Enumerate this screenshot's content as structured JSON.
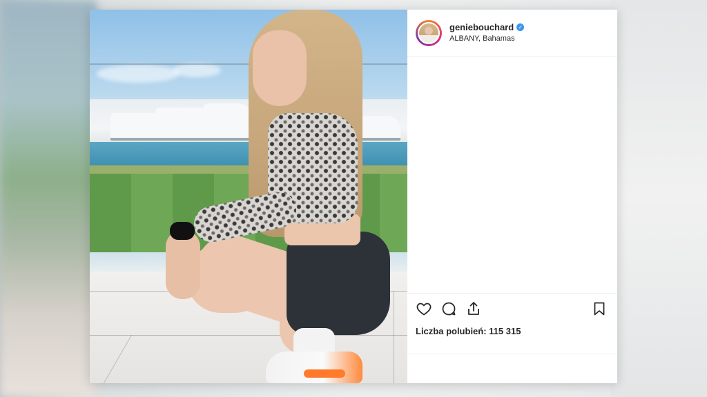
{
  "post": {
    "username": "geniebouchard",
    "verified": true,
    "location": "ALBANY, Bahamas",
    "likes_text": "Liczba polubień: 115 315"
  },
  "icons": {
    "like": "heart-outline-icon",
    "comment": "speech-bubble-icon",
    "share": "share-upload-icon",
    "save": "bookmark-icon",
    "verified": "verified-check-icon"
  },
  "colors": {
    "verified": "#3897f0",
    "text": "#262626",
    "divider": "#efefef"
  }
}
